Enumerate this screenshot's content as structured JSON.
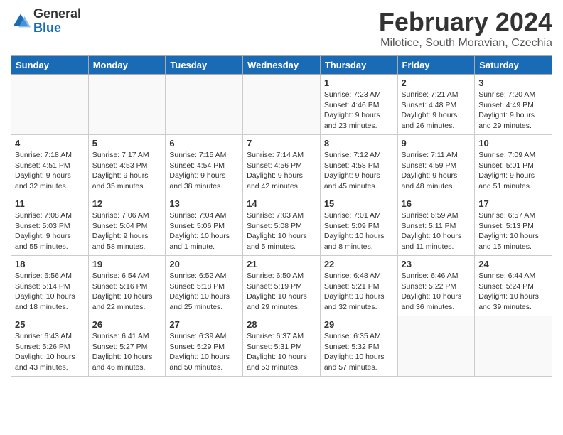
{
  "header": {
    "logo": {
      "general": "General",
      "blue": "Blue"
    },
    "title": "February 2024",
    "subtitle": "Milotice, South Moravian, Czechia"
  },
  "calendar": {
    "weekdays": [
      "Sunday",
      "Monday",
      "Tuesday",
      "Wednesday",
      "Thursday",
      "Friday",
      "Saturday"
    ],
    "weeks": [
      [
        {
          "day": "",
          "info": ""
        },
        {
          "day": "",
          "info": ""
        },
        {
          "day": "",
          "info": ""
        },
        {
          "day": "",
          "info": ""
        },
        {
          "day": "1",
          "info": "Sunrise: 7:23 AM\nSunset: 4:46 PM\nDaylight: 9 hours\nand 23 minutes."
        },
        {
          "day": "2",
          "info": "Sunrise: 7:21 AM\nSunset: 4:48 PM\nDaylight: 9 hours\nand 26 minutes."
        },
        {
          "day": "3",
          "info": "Sunrise: 7:20 AM\nSunset: 4:49 PM\nDaylight: 9 hours\nand 29 minutes."
        }
      ],
      [
        {
          "day": "4",
          "info": "Sunrise: 7:18 AM\nSunset: 4:51 PM\nDaylight: 9 hours\nand 32 minutes."
        },
        {
          "day": "5",
          "info": "Sunrise: 7:17 AM\nSunset: 4:53 PM\nDaylight: 9 hours\nand 35 minutes."
        },
        {
          "day": "6",
          "info": "Sunrise: 7:15 AM\nSunset: 4:54 PM\nDaylight: 9 hours\nand 38 minutes."
        },
        {
          "day": "7",
          "info": "Sunrise: 7:14 AM\nSunset: 4:56 PM\nDaylight: 9 hours\nand 42 minutes."
        },
        {
          "day": "8",
          "info": "Sunrise: 7:12 AM\nSunset: 4:58 PM\nDaylight: 9 hours\nand 45 minutes."
        },
        {
          "day": "9",
          "info": "Sunrise: 7:11 AM\nSunset: 4:59 PM\nDaylight: 9 hours\nand 48 minutes."
        },
        {
          "day": "10",
          "info": "Sunrise: 7:09 AM\nSunset: 5:01 PM\nDaylight: 9 hours\nand 51 minutes."
        }
      ],
      [
        {
          "day": "11",
          "info": "Sunrise: 7:08 AM\nSunset: 5:03 PM\nDaylight: 9 hours\nand 55 minutes."
        },
        {
          "day": "12",
          "info": "Sunrise: 7:06 AM\nSunset: 5:04 PM\nDaylight: 9 hours\nand 58 minutes."
        },
        {
          "day": "13",
          "info": "Sunrise: 7:04 AM\nSunset: 5:06 PM\nDaylight: 10 hours\nand 1 minute."
        },
        {
          "day": "14",
          "info": "Sunrise: 7:03 AM\nSunset: 5:08 PM\nDaylight: 10 hours\nand 5 minutes."
        },
        {
          "day": "15",
          "info": "Sunrise: 7:01 AM\nSunset: 5:09 PM\nDaylight: 10 hours\nand 8 minutes."
        },
        {
          "day": "16",
          "info": "Sunrise: 6:59 AM\nSunset: 5:11 PM\nDaylight: 10 hours\nand 11 minutes."
        },
        {
          "day": "17",
          "info": "Sunrise: 6:57 AM\nSunset: 5:13 PM\nDaylight: 10 hours\nand 15 minutes."
        }
      ],
      [
        {
          "day": "18",
          "info": "Sunrise: 6:56 AM\nSunset: 5:14 PM\nDaylight: 10 hours\nand 18 minutes."
        },
        {
          "day": "19",
          "info": "Sunrise: 6:54 AM\nSunset: 5:16 PM\nDaylight: 10 hours\nand 22 minutes."
        },
        {
          "day": "20",
          "info": "Sunrise: 6:52 AM\nSunset: 5:18 PM\nDaylight: 10 hours\nand 25 minutes."
        },
        {
          "day": "21",
          "info": "Sunrise: 6:50 AM\nSunset: 5:19 PM\nDaylight: 10 hours\nand 29 minutes."
        },
        {
          "day": "22",
          "info": "Sunrise: 6:48 AM\nSunset: 5:21 PM\nDaylight: 10 hours\nand 32 minutes."
        },
        {
          "day": "23",
          "info": "Sunrise: 6:46 AM\nSunset: 5:22 PM\nDaylight: 10 hours\nand 36 minutes."
        },
        {
          "day": "24",
          "info": "Sunrise: 6:44 AM\nSunset: 5:24 PM\nDaylight: 10 hours\nand 39 minutes."
        }
      ],
      [
        {
          "day": "25",
          "info": "Sunrise: 6:43 AM\nSunset: 5:26 PM\nDaylight: 10 hours\nand 43 minutes."
        },
        {
          "day": "26",
          "info": "Sunrise: 6:41 AM\nSunset: 5:27 PM\nDaylight: 10 hours\nand 46 minutes."
        },
        {
          "day": "27",
          "info": "Sunrise: 6:39 AM\nSunset: 5:29 PM\nDaylight: 10 hours\nand 50 minutes."
        },
        {
          "day": "28",
          "info": "Sunrise: 6:37 AM\nSunset: 5:31 PM\nDaylight: 10 hours\nand 53 minutes."
        },
        {
          "day": "29",
          "info": "Sunrise: 6:35 AM\nSunset: 5:32 PM\nDaylight: 10 hours\nand 57 minutes."
        },
        {
          "day": "",
          "info": ""
        },
        {
          "day": "",
          "info": ""
        }
      ]
    ]
  }
}
